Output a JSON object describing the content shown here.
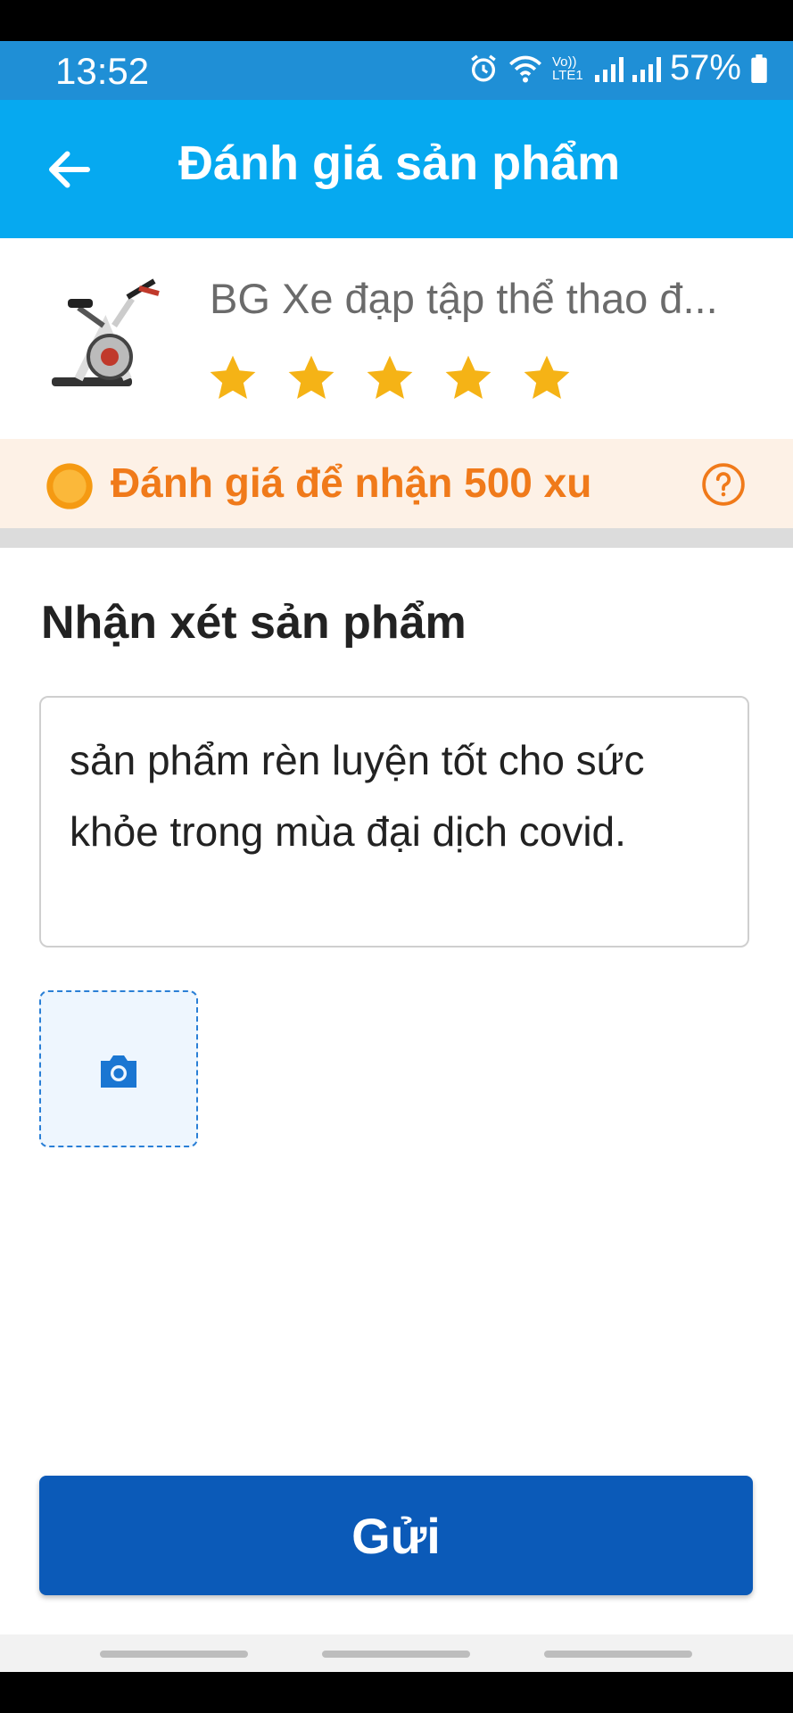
{
  "status_bar": {
    "time": "13:52",
    "network_label": "Vo)) LTE1",
    "battery": "57%"
  },
  "header": {
    "title": "Đánh giá sản phẩm",
    "back_icon": "arrow-left-icon"
  },
  "product": {
    "name": "BG Xe đạp tập thể thao đ...",
    "rating": 5,
    "max_rating": 5,
    "star_color": "#f5b316"
  },
  "reward": {
    "text": "Đánh giá để nhận 500 xu",
    "color": "#f07a1a"
  },
  "review": {
    "section_title": "Nhận xét sản phẩm",
    "comment": "sản phẩm rèn luyện tốt cho sức khỏe trong mùa đại dịch covid."
  },
  "actions": {
    "submit_label": "Gửi",
    "submit_color": "#0b5ab8"
  },
  "colors": {
    "app_bar": "#06a9f0",
    "status_bar": "#1f8fd6"
  }
}
